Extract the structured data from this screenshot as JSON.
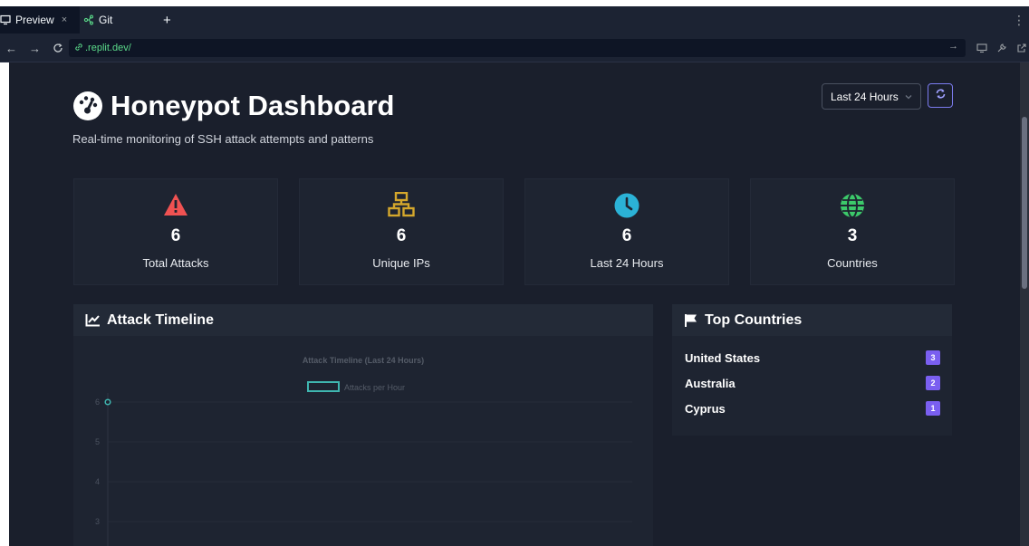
{
  "browser": {
    "tabs": [
      {
        "label": "Preview",
        "close": "×"
      },
      {
        "label": "Git"
      }
    ],
    "new_tab": "+",
    "url": ".replit.dev/"
  },
  "dashboard": {
    "title": "Honeypot Dashboard",
    "subtitle": "Real-time monitoring of SSH attack attempts and patterns",
    "time_range": {
      "selected": "Last 24 Hours"
    },
    "stats": [
      {
        "icon": "warning-triangle-icon",
        "value": "6",
        "label": "Total Attacks",
        "color": "#f05252"
      },
      {
        "icon": "network-icon",
        "value": "6",
        "label": "Unique IPs",
        "color": "#d4a72c"
      },
      {
        "icon": "clock-icon",
        "value": "6",
        "label": "Last 24 Hours",
        "color": "#2bb2d6"
      },
      {
        "icon": "globe-icon",
        "value": "3",
        "label": "Countries",
        "color": "#3cc96a"
      }
    ],
    "timeline_panel": {
      "title": "Attack Timeline"
    },
    "countries_panel": {
      "title": "Top Countries",
      "items": [
        {
          "name": "United States",
          "count": "3"
        },
        {
          "name": "Australia",
          "count": "2"
        },
        {
          "name": "Cyprus",
          "count": "1"
        }
      ]
    },
    "colors": {
      "accent": "#7a5ff0",
      "line": "#3fb6b0",
      "background": "#1a1f2c"
    }
  },
  "chart_data": {
    "type": "line",
    "title": "Attack Timeline (Last 24 Hours)",
    "series": [
      {
        "name": "Attacks per Hour",
        "x": [
          0
        ],
        "values": [
          6
        ]
      }
    ],
    "y_ticks": [
      "6",
      "5",
      "4",
      "3"
    ],
    "ylim": [
      3,
      6
    ],
    "grid": true,
    "legend": "top"
  }
}
